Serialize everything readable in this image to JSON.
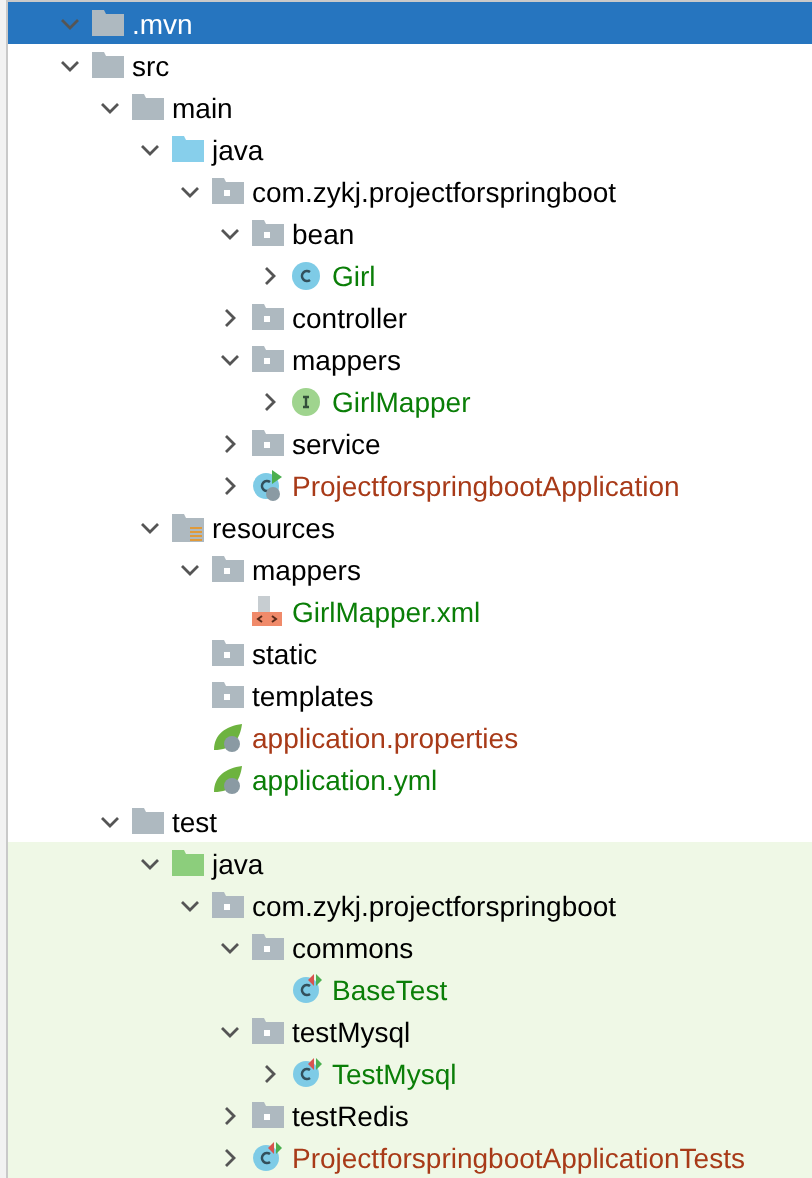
{
  "tree": [
    {
      "label": ".mvn",
      "kind": "folder",
      "expanded": true,
      "selected": true,
      "color": "#ffffff"
    },
    {
      "label": "src",
      "kind": "folder",
      "expanded": true,
      "selected": false,
      "color": "#000000",
      "children": [
        {
          "label": "main",
          "kind": "folder",
          "expanded": true,
          "selected": false,
          "color": "#000000",
          "children": [
            {
              "label": "java",
              "kind": "source_root",
              "expanded": true,
              "selected": false,
              "color": "#000000",
              "children": [
                {
                  "label": "com.zykj.projectforspringboot",
                  "kind": "package",
                  "expanded": true,
                  "selected": false,
                  "color": "#000000",
                  "children": [
                    {
                      "label": "bean",
                      "kind": "package",
                      "expanded": true,
                      "selected": false,
                      "color": "#000000",
                      "children": [
                        {
                          "label": "Girl",
                          "kind": "class",
                          "expanded": false,
                          "selected": false,
                          "color": "#0a7e07"
                        }
                      ]
                    },
                    {
                      "label": "controller",
                      "kind": "package",
                      "expanded": false,
                      "selected": false,
                      "color": "#000000"
                    },
                    {
                      "label": "mappers",
                      "kind": "package",
                      "expanded": true,
                      "selected": false,
                      "color": "#000000",
                      "children": [
                        {
                          "label": "GirlMapper",
                          "kind": "interface",
                          "expanded": false,
                          "selected": false,
                          "color": "#0a7e07"
                        }
                      ]
                    },
                    {
                      "label": "service",
                      "kind": "package",
                      "expanded": false,
                      "selected": false,
                      "color": "#000000"
                    },
                    {
                      "label": "ProjectforspringbootApplication",
                      "kind": "spring_app",
                      "expanded": false,
                      "selected": false,
                      "color": "#a83a18"
                    }
                  ]
                }
              ]
            },
            {
              "label": "resources",
              "kind": "resources",
              "expanded": true,
              "selected": false,
              "color": "#000000",
              "children": [
                {
                  "label": "mappers",
                  "kind": "package",
                  "expanded": true,
                  "selected": false,
                  "color": "#000000",
                  "children": [
                    {
                      "label": "GirlMapper.xml",
                      "kind": "xml",
                      "selected": false,
                      "color": "#0a7e07"
                    }
                  ]
                },
                {
                  "label": "static",
                  "kind": "package",
                  "selected": false,
                  "color": "#000000"
                },
                {
                  "label": "templates",
                  "kind": "package",
                  "selected": false,
                  "color": "#000000"
                },
                {
                  "label": "application.properties",
                  "kind": "spring_config",
                  "selected": false,
                  "color": "#a83a18"
                },
                {
                  "label": "application.yml",
                  "kind": "spring_config",
                  "selected": false,
                  "color": "#0a7e07"
                }
              ]
            }
          ]
        },
        {
          "label": "test",
          "kind": "folder",
          "expanded": true,
          "selected": false,
          "color": "#000000",
          "children": [
            {
              "label": "java",
              "kind": "test_root",
              "expanded": true,
              "selected": false,
              "color": "#000000",
              "test_scope": true,
              "children": [
                {
                  "label": "com.zykj.projectforspringboot",
                  "kind": "package",
                  "expanded": true,
                  "selected": false,
                  "color": "#000000",
                  "children": [
                    {
                      "label": "commons",
                      "kind": "package",
                      "expanded": true,
                      "selected": false,
                      "color": "#000000",
                      "children": [
                        {
                          "label": "BaseTest",
                          "kind": "test_class",
                          "selected": false,
                          "color": "#0a7e07"
                        }
                      ]
                    },
                    {
                      "label": "testMysql",
                      "kind": "package",
                      "expanded": true,
                      "selected": false,
                      "color": "#000000",
                      "children": [
                        {
                          "label": "TestMysql",
                          "kind": "test_class",
                          "expanded": false,
                          "selected": false,
                          "color": "#0a7e07"
                        }
                      ]
                    },
                    {
                      "label": "testRedis",
                      "kind": "package",
                      "expanded": false,
                      "selected": false,
                      "color": "#000000"
                    },
                    {
                      "label": "ProjectforspringbootApplicationTests",
                      "kind": "test_class",
                      "expanded": false,
                      "selected": false,
                      "color": "#a83a18"
                    }
                  ]
                }
              ]
            }
          ]
        }
      ]
    }
  ]
}
